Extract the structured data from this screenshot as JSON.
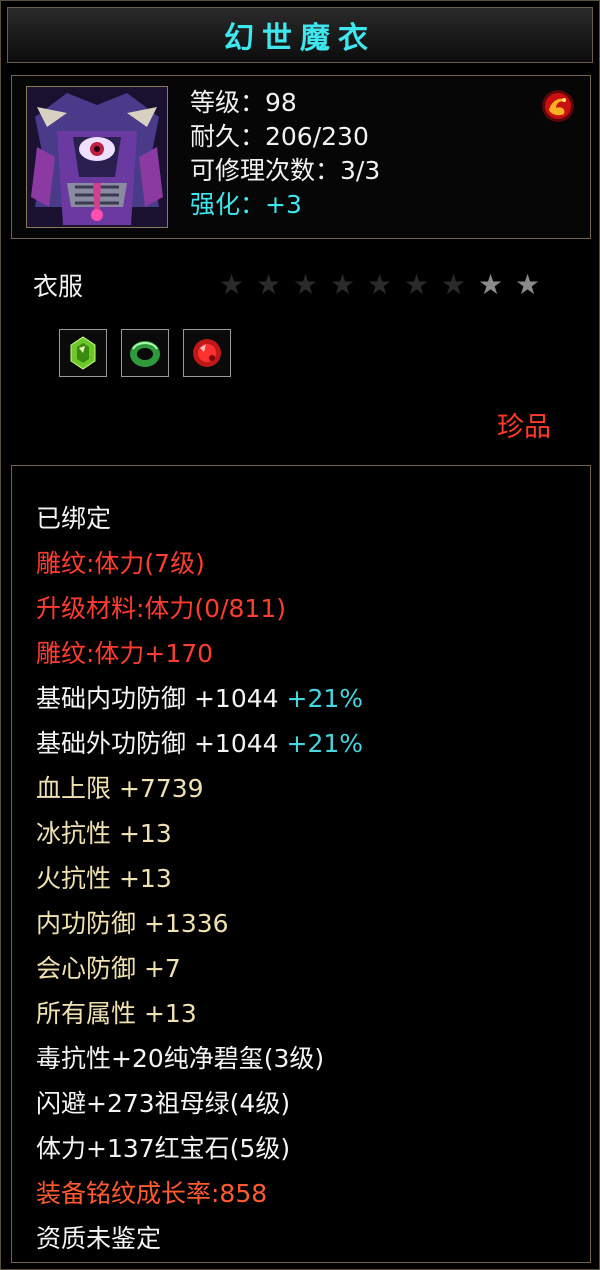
{
  "item": {
    "name": "幻世魔衣",
    "icon": "armor-portrait-icon",
    "level": "等级：98",
    "durability": "耐久：206/230",
    "repairs": "可修理次数：3/3",
    "enhance_label": "强化：",
    "enhance_value": "+3",
    "type": "衣服",
    "rarity": "珍品",
    "star_level": 2,
    "star_max": 9
  },
  "gems": [
    {
      "icon": "green-gem-icon",
      "color": "#7acc2a"
    },
    {
      "icon": "jade-ring-icon",
      "color": "#2e9a3c"
    },
    {
      "icon": "ruby-gem-icon",
      "color": "#d42020"
    }
  ],
  "attributes": {
    "bound": "已绑定",
    "carving": "雕纹:体力(7级)",
    "upgrade_material": "升级材料:体力(0/811)",
    "carving_bonus": "雕纹:体力+170",
    "base_inner_def": {
      "label": "基础内功防御",
      "value": "+1044",
      "pct": "+21%"
    },
    "base_outer_def": {
      "label": "基础外功防御",
      "value": "+1044",
      "pct": "+21%"
    },
    "hp_max": {
      "label": "血上限",
      "value": "+7739"
    },
    "ice_res": {
      "label": "冰抗性",
      "value": "+13"
    },
    "fire_res": {
      "label": "火抗性",
      "value": "+13"
    },
    "inner_def": {
      "label": "内功防御",
      "value": "+1336"
    },
    "crit_def": {
      "label": "会心防御",
      "value": "+7"
    },
    "all_attr": {
      "label": "所有属性",
      "value": "+13"
    },
    "gem_line_1": "毒抗性+20纯净碧玺(3级)",
    "gem_line_2": "闪避+273祖母绿(4级)",
    "gem_line_3": "体力+137红宝石(5级)",
    "growth_rate": "装备铭纹成长率:858",
    "quality": "资质未鉴定"
  },
  "colors": {
    "title": "#3ee6ee",
    "red_text": "#ff3c30",
    "gold_text": "#efe1b0",
    "cyan_text": "#46d6e0",
    "rarity": "#ff3a2a"
  }
}
